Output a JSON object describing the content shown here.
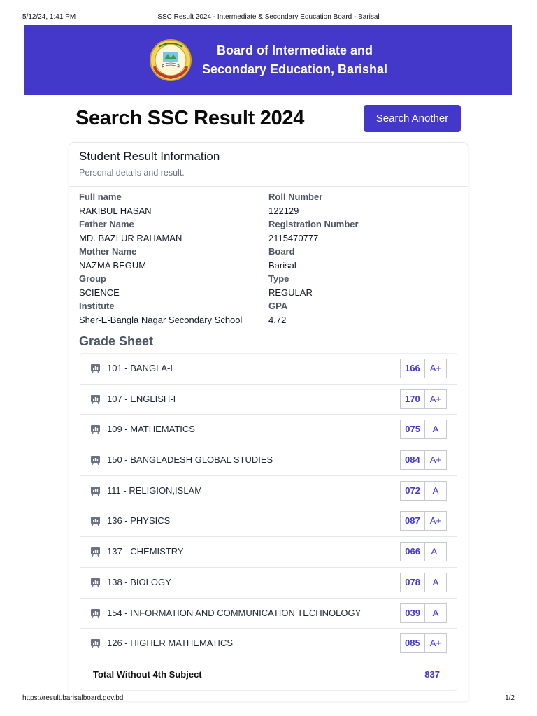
{
  "print_header": {
    "date": "5/12/24, 1:41 PM",
    "title": "SSC Result 2024 - Intermediate & Secondary Education Board - Barisal"
  },
  "banner": {
    "line1": "Board of Intermediate and",
    "line2": "Secondary Education, Barishal",
    "color": "#4338ca",
    "logo_icon": "board-seal-icon"
  },
  "page": {
    "title": "Search SSC Result 2024",
    "search_button": "Search Another"
  },
  "card": {
    "title": "Student Result Information",
    "subtitle": "Personal details and result."
  },
  "student": {
    "left": [
      {
        "label": "Full name",
        "value": "RAKIBUL HASAN"
      },
      {
        "label": "Father Name",
        "value": "MD. BAZLUR RAHAMAN"
      },
      {
        "label": "Mother Name",
        "value": "NAZMA BEGUM"
      },
      {
        "label": "Group",
        "value": "SCIENCE"
      },
      {
        "label": "Institute",
        "value": "Sher-E-Bangla Nagar Secondary School"
      }
    ],
    "right": [
      {
        "label": "Roll Number",
        "value": "122129"
      },
      {
        "label": "Registration Number",
        "value": "2115470777"
      },
      {
        "label": "Board",
        "value": "Barisal"
      },
      {
        "label": "Type",
        "value": "REGULAR"
      },
      {
        "label": "GPA",
        "value": "4.72"
      }
    ]
  },
  "grade_sheet": {
    "title": "Grade Sheet",
    "subjects": [
      {
        "name": "101 - BANGLA-I",
        "mark": "166",
        "grade": "A+"
      },
      {
        "name": "107 - ENGLISH-I",
        "mark": "170",
        "grade": "A+"
      },
      {
        "name": "109 - MATHEMATICS",
        "mark": "075",
        "grade": "A"
      },
      {
        "name": "150 - BANGLADESH GLOBAL STUDIES",
        "mark": "084",
        "grade": "A+"
      },
      {
        "name": "111 - RELIGION,ISLAM",
        "mark": "072",
        "grade": "A"
      },
      {
        "name": "136 - PHYSICS",
        "mark": "087",
        "grade": "A+"
      },
      {
        "name": "137 - CHEMISTRY",
        "mark": "066",
        "grade": "A-"
      },
      {
        "name": "138 - BIOLOGY",
        "mark": "078",
        "grade": "A"
      },
      {
        "name": "154 - INFORMATION AND COMMUNICATION TECHNOLOGY",
        "mark": "039",
        "grade": "A"
      },
      {
        "name": "126 - HIGHER MATHEMATICS",
        "mark": "085",
        "grade": "A+"
      }
    ],
    "total_label": "Total Without 4th Subject",
    "total_value": "837"
  },
  "print_footer": {
    "url": "https://result.barisalboard.gov.bd",
    "page": "1/2"
  }
}
